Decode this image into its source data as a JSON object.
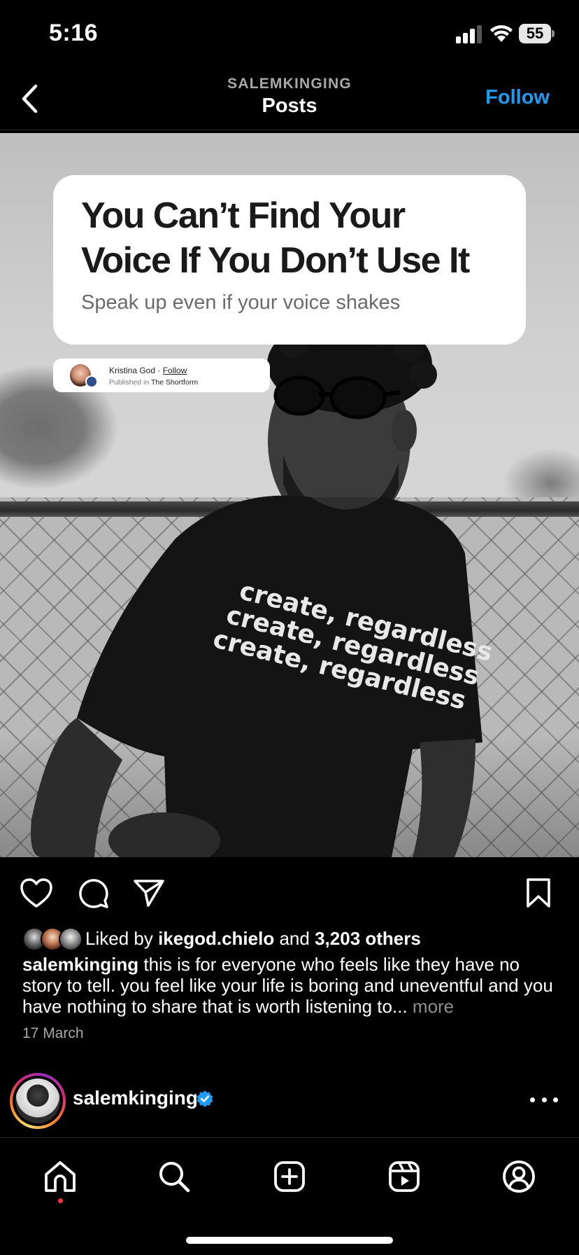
{
  "status_bar": {
    "time": "5:16",
    "battery": "55"
  },
  "top_nav": {
    "username": "SALEMKINGING",
    "title": "Posts",
    "follow_label": "Follow"
  },
  "post": {
    "article_card": {
      "title": "You Can’t Find Your Voice If You Don’t Use It",
      "subtitle": "Speak up even if your voice shakes",
      "author": "Kristina God",
      "separator": "·",
      "follow": "Follow",
      "published_prefix": "Published in",
      "publication": "The Shortform"
    },
    "likes": {
      "prefix": "Liked by",
      "user": "ikegod.chielo",
      "connector": "and",
      "others": "3,203 others"
    },
    "caption": {
      "username": "salemkinging",
      "text": "this is for everyone who feels like they have no story to tell. you feel like your life is boring and uneventful and you have nothing to share that is worth listening to...",
      "more": "more"
    },
    "date": "17 March"
  },
  "next_post": {
    "username": "salemkinging",
    "verified": true
  },
  "icons": {
    "back": "chevron-left-icon",
    "like": "heart-icon",
    "comment": "comment-icon",
    "share": "paper-plane-icon",
    "save": "bookmark-icon",
    "more": "ellipsis-icon",
    "tabs": [
      "home-icon",
      "search-icon",
      "create-icon",
      "reels-icon",
      "profile-icon"
    ]
  },
  "colors": {
    "accent": "#1e9bf5",
    "background": "#000000",
    "notification_dot": "#ff3040",
    "verified": "#1e9bf5"
  }
}
